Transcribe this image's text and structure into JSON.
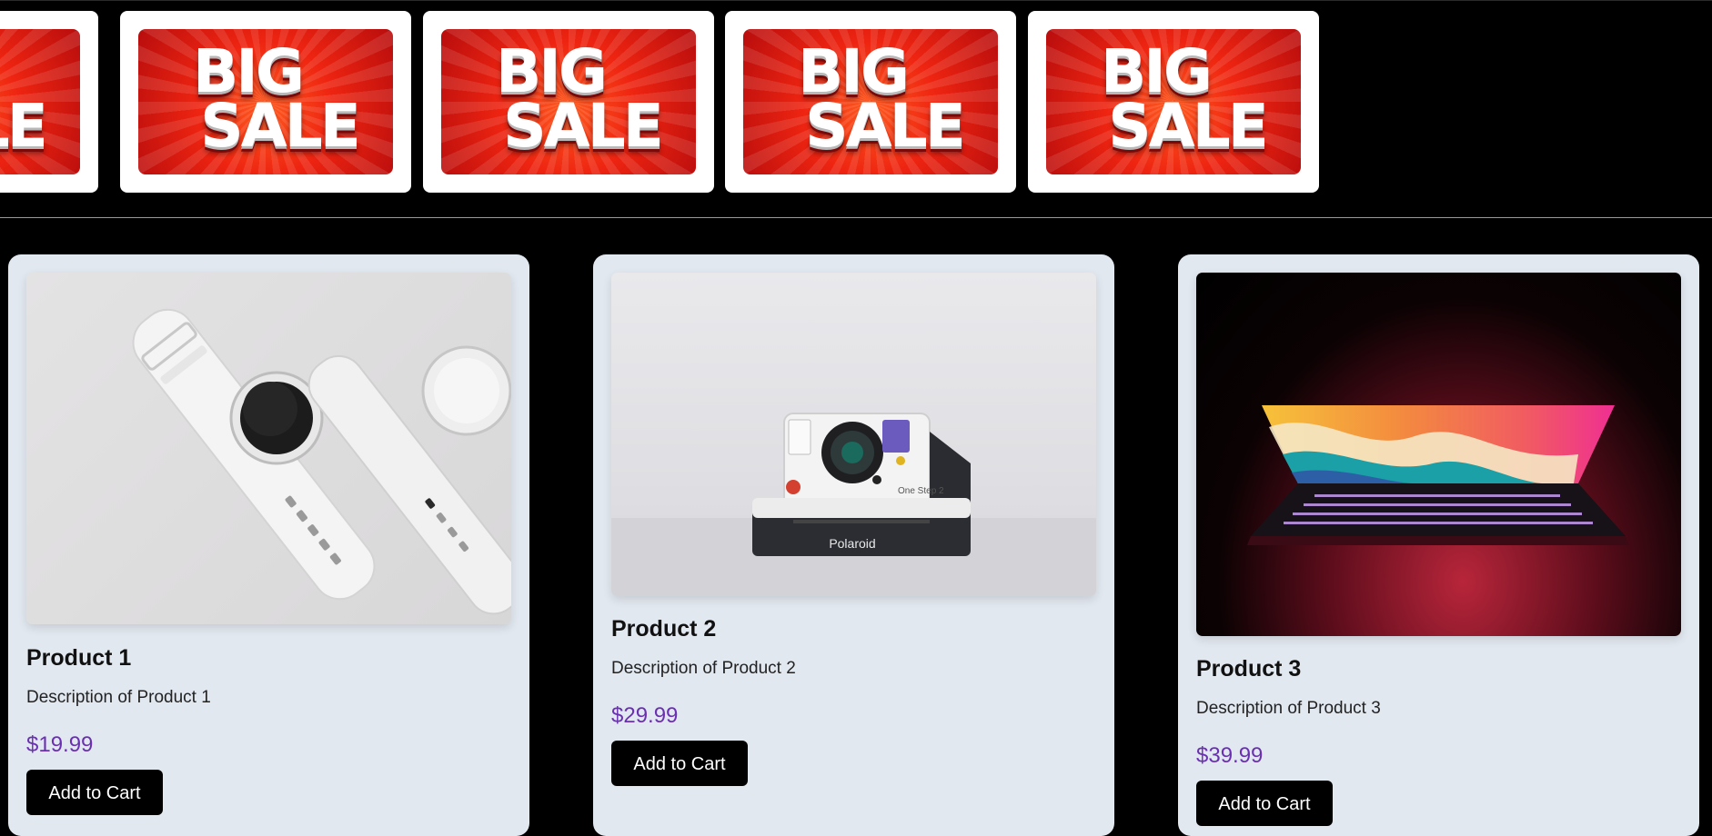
{
  "banner": {
    "word_top": "BIG",
    "word_bottom": "SALE",
    "colors": {
      "red": "#ee2411",
      "dark_red": "#b80d0d"
    }
  },
  "products": [
    {
      "title": "Product 1",
      "description": "Description of Product 1",
      "price": "$19.99",
      "button": "Add to Cart",
      "image": "smartwatch-pair-photo"
    },
    {
      "title": "Product 2",
      "description": "Description of Product 2",
      "price": "$29.99",
      "button": "Add to Cart",
      "image": "instant-camera-photo",
      "camera_brand": "Polaroid",
      "camera_model": "One Step 2"
    },
    {
      "title": "Product 3",
      "description": "Description of Product 3",
      "price": "$39.99",
      "button": "Add to Cart",
      "image": "laptop-photo"
    }
  ],
  "colors": {
    "background": "#000000",
    "card": "#e2e8f0",
    "price": "#6b2fb3",
    "button": "#000000"
  }
}
